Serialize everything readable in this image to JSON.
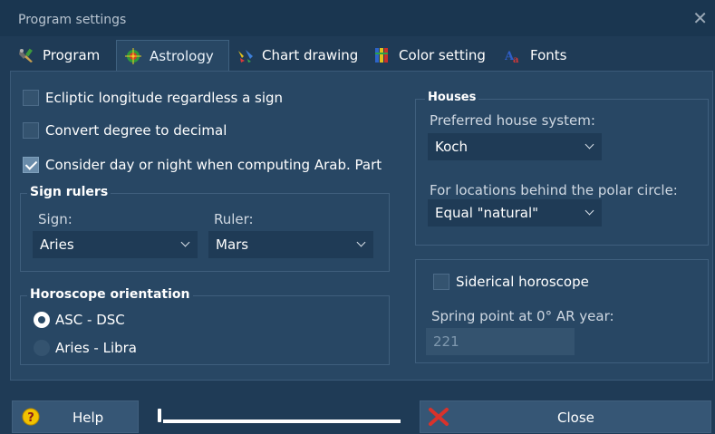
{
  "window": {
    "title": "Program settings"
  },
  "tabs": [
    {
      "label": "Program",
      "icon": "program-icon"
    },
    {
      "label": "Astrology",
      "icon": "astrology-icon",
      "active": true
    },
    {
      "label": "Chart drawing",
      "icon": "chart-drawing-icon"
    },
    {
      "label": "Color setting",
      "icon": "color-setting-icon"
    },
    {
      "label": "Fonts",
      "icon": "fonts-icon"
    }
  ],
  "options": {
    "ecliptic": {
      "label": "Ecliptic longitude regardless a sign",
      "checked": false
    },
    "convert_degree": {
      "label": "Convert degree to decimal",
      "checked": false
    },
    "day_night": {
      "label": "Consider day or night when computing Arab. Part",
      "checked": true
    }
  },
  "sign_rulers": {
    "title": "Sign rulers",
    "sign_label": "Sign:",
    "ruler_label": "Ruler:",
    "sign_value": "Aries",
    "ruler_value": "Mars"
  },
  "orientation": {
    "title": "Horoscope orientation",
    "options": [
      {
        "label": "ASC - DSC",
        "selected": true
      },
      {
        "label": "Aries - Libra",
        "selected": false
      }
    ]
  },
  "houses": {
    "title": "Houses",
    "preferred_label": "Preferred house system:",
    "preferred_value": "Koch",
    "polar_label": "For locations behind the polar circle:",
    "polar_value": "Equal \"natural\""
  },
  "siderical": {
    "label": "Siderical horoscope",
    "checked": false,
    "spring_label": "Spring point at 0° AR year:",
    "spring_value": "221"
  },
  "footer": {
    "help_label": "Help",
    "close_label": "Close"
  },
  "colors": {
    "background": "#1f3b56",
    "panel": "#284764",
    "help_icon": "#f2c200",
    "close_icon": "#d9322b"
  }
}
